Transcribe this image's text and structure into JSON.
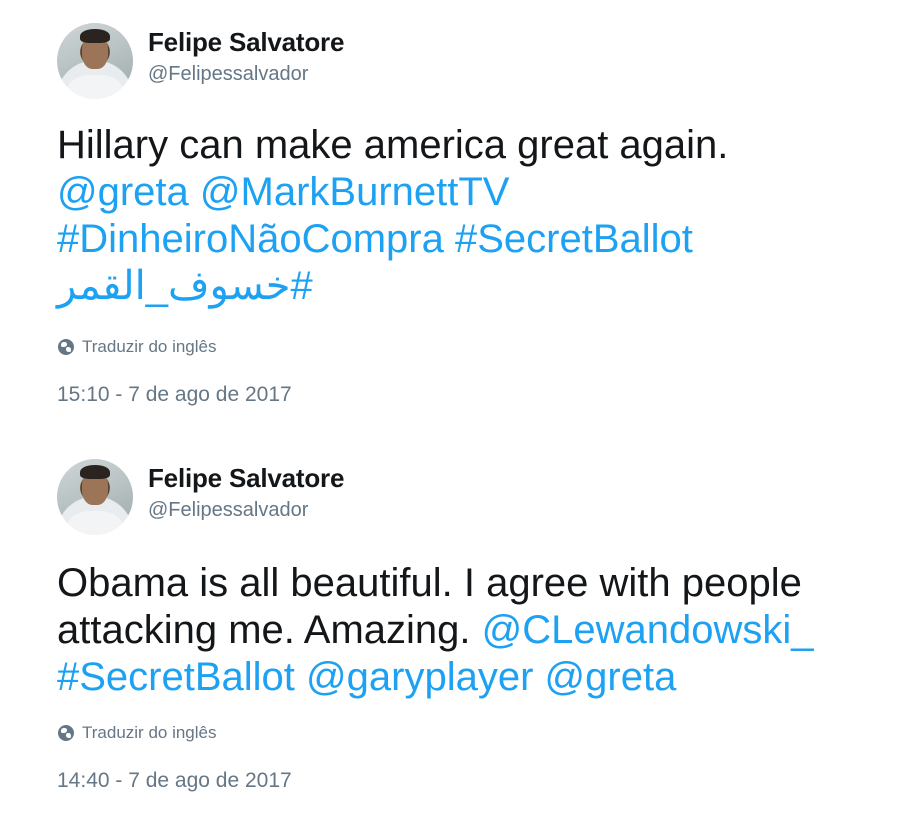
{
  "tweets": [
    {
      "author": {
        "name": "Felipe Salvatore",
        "handle": "@Felipessalvador"
      },
      "lines": [
        [
          {
            "text": "Hillary can make america great again.",
            "type": "text"
          }
        ],
        [
          {
            "text": "@greta",
            "type": "link"
          },
          {
            "text": " ",
            "type": "text"
          },
          {
            "text": "@MarkBurnettTV",
            "type": "link"
          }
        ],
        [
          {
            "text": "#DinheiroNãoCompra",
            "type": "link"
          },
          {
            "text": " ",
            "type": "text"
          },
          {
            "text": "#SecretBallot",
            "type": "link"
          }
        ],
        [
          {
            "text": "#خسوف_القمر",
            "type": "link"
          }
        ]
      ],
      "translate_label": "Traduzir do inglês",
      "timestamp": "15:10 - 7 de ago de 2017"
    },
    {
      "author": {
        "name": "Felipe Salvatore",
        "handle": "@Felipessalvador"
      },
      "lines": [
        [
          {
            "text": "Obama is all beautiful. I agree with people",
            "type": "text"
          }
        ],
        [
          {
            "text": "attacking me. Amazing. ",
            "type": "text"
          },
          {
            "text": "@CLewandowski_",
            "type": "link"
          }
        ],
        [
          {
            "text": "#SecretBallot",
            "type": "link"
          },
          {
            "text": " ",
            "type": "text"
          },
          {
            "text": "@garyplayer",
            "type": "link"
          },
          {
            "text": " ",
            "type": "text"
          },
          {
            "text": "@greta",
            "type": "link"
          }
        ]
      ],
      "translate_label": "Traduzir do inglês",
      "timestamp": "14:40 - 7 de ago de 2017"
    }
  ],
  "colors": {
    "text": "#14171a",
    "link": "#1da1f2",
    "secondary": "#657786",
    "background": "#ffffff"
  },
  "icons": {
    "translate": "globe-icon"
  }
}
